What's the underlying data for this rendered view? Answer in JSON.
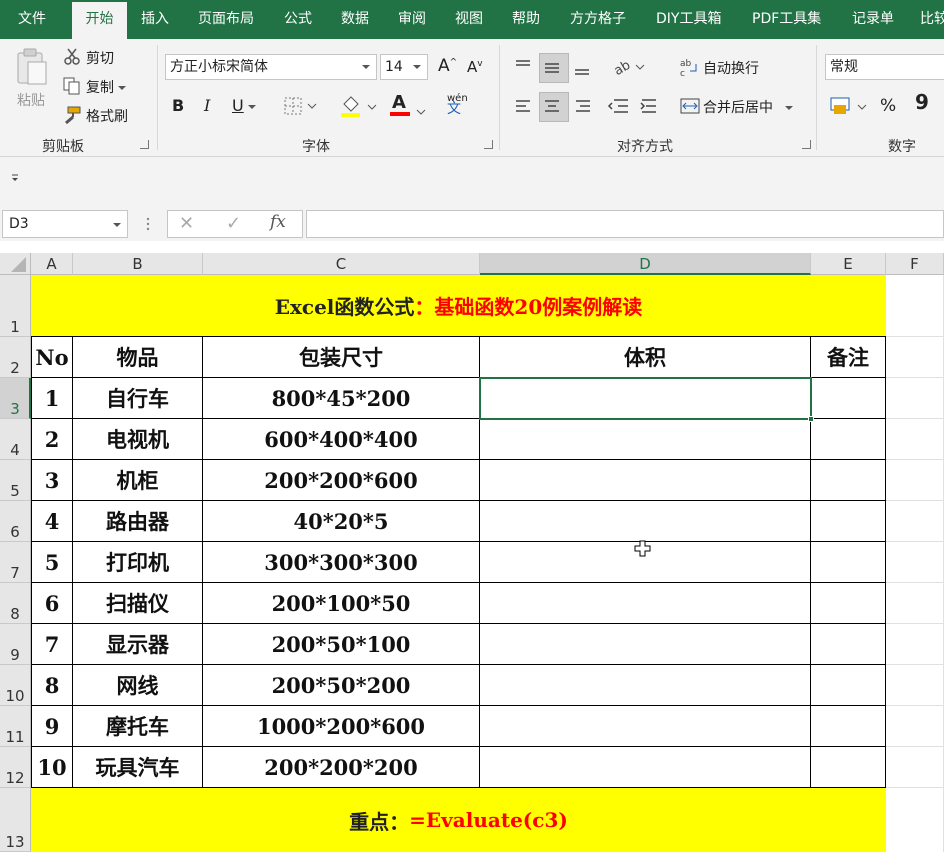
{
  "tabs": [
    "文件",
    "开始",
    "插入",
    "页面布局",
    "公式",
    "数据",
    "审阅",
    "视图",
    "帮助",
    "方方格子",
    "DIY工具箱",
    "PDF工具集",
    "记录单",
    "比较"
  ],
  "ribbon": {
    "clipboard": {
      "paste": "粘贴",
      "cut": "剪切",
      "copy": "复制",
      "format_painter": "格式刷",
      "group": "剪贴板"
    },
    "font": {
      "name": "方正小标宋简体",
      "size": "14",
      "bold": "B",
      "italic": "I",
      "underline": "U",
      "font_color_letter": "A",
      "phonetic": "wén",
      "phonetic_char": "文",
      "group": "字体",
      "increase": "A",
      "decrease": "A"
    },
    "align": {
      "wrap": "自动换行",
      "merge": "合并后居中",
      "group": "对齐方式"
    },
    "number": {
      "format": "常规",
      "percent": "%",
      "comma": "9",
      "group": "数字"
    }
  },
  "formula_bar": {
    "cell_ref": "D3",
    "cancel": "✕",
    "enter": "✓",
    "fx": "fx",
    "value": ""
  },
  "columns": [
    "A",
    "B",
    "C",
    "D",
    "E",
    "F"
  ],
  "rows": [
    "1",
    "2",
    "3",
    "4",
    "5",
    "6",
    "7",
    "8",
    "9",
    "10",
    "11",
    "12",
    "13"
  ],
  "sheet": {
    "title_black": "Excel函数公式",
    "title_red": "：基础函数20例案例解读",
    "headers": [
      "No",
      "物品",
      "包装尺寸",
      "体积",
      "备注"
    ],
    "items": [
      {
        "no": "1",
        "name": "自行车",
        "size": "800*45*200"
      },
      {
        "no": "2",
        "name": "电视机",
        "size": "600*400*400"
      },
      {
        "no": "3",
        "name": "机柜",
        "size": "200*200*600"
      },
      {
        "no": "4",
        "name": "路由器",
        "size": "40*20*5"
      },
      {
        "no": "5",
        "name": "打印机",
        "size": "300*300*300"
      },
      {
        "no": "6",
        "name": "扫描仪",
        "size": "200*100*50"
      },
      {
        "no": "7",
        "name": "显示器",
        "size": "200*50*100"
      },
      {
        "no": "8",
        "name": "网线",
        "size": "200*50*200"
      },
      {
        "no": "9",
        "name": "摩托车",
        "size": "1000*200*600"
      },
      {
        "no": "10",
        "name": "玩具汽车",
        "size": "200*200*200"
      }
    ],
    "footer_black": "重点：",
    "footer_red": "=Evaluate(c3)"
  },
  "colors": {
    "excel_green": "#217346",
    "highlight": "#ffff00",
    "red_text": "#ff0000"
  }
}
